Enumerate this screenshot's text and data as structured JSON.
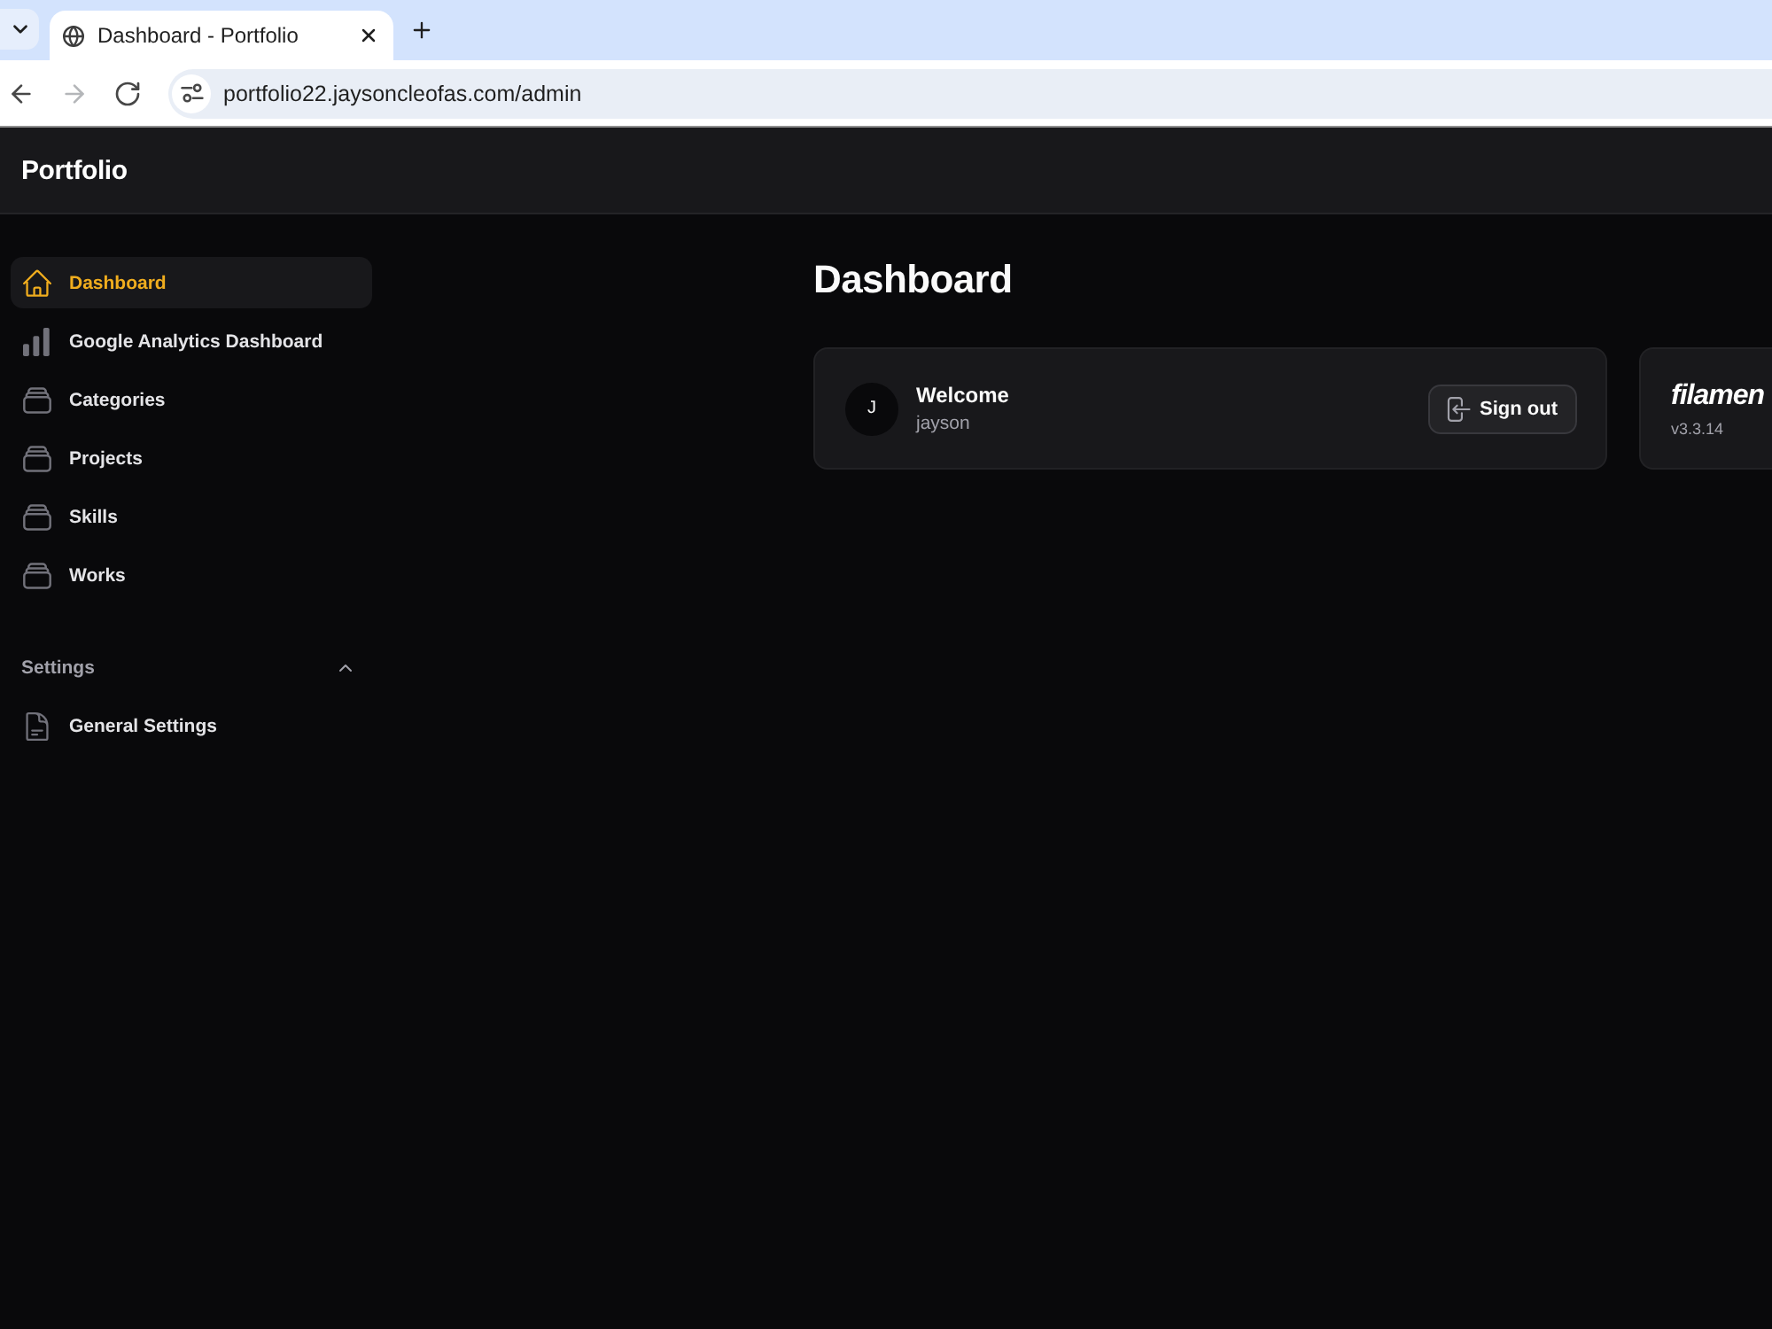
{
  "browser": {
    "tabs": [
      {
        "title": "Dashboard - Portfolio",
        "selected": true
      }
    ],
    "nav_buttons": [
      {
        "kind": "back",
        "disabled": false
      },
      {
        "kind": "forward",
        "disabled": true
      },
      {
        "kind": "reload",
        "disabled": false
      }
    ],
    "address": {
      "url": "portfolio22.jaysoncleofas.com/admin"
    }
  },
  "app": {
    "brand": "Portfolio"
  },
  "sidebar": {
    "items": [
      {
        "kind": "dashboard",
        "label": "Dashboard",
        "selected": true
      },
      {
        "kind": "analytics",
        "label": "Google Analytics Dashboard",
        "selected": false
      },
      {
        "kind": "resource",
        "label": "Categories",
        "selected": false
      },
      {
        "kind": "resource",
        "label": "Projects",
        "selected": false
      },
      {
        "kind": "resource",
        "label": "Skills",
        "selected": false
      },
      {
        "kind": "resource",
        "label": "Works",
        "selected": false
      }
    ],
    "groups": [
      {
        "label": "Settings",
        "expanded": true,
        "items": [
          {
            "kind": "document",
            "label": "General Settings",
            "selected": false
          }
        ]
      }
    ]
  },
  "page": {
    "title": "Dashboard"
  },
  "widgets": [
    {
      "kind": "account",
      "avatar": "J",
      "title": "Welcome",
      "name": "jayson",
      "button": "Sign out"
    },
    {
      "kind": "info",
      "logo": "filamen",
      "version": "v3.3.14"
    }
  ]
}
